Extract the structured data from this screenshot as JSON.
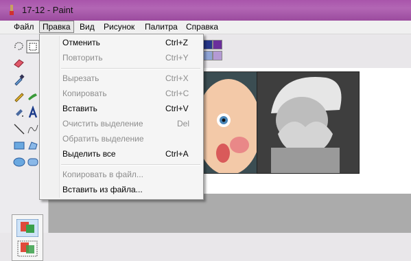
{
  "window": {
    "title": "17-12 - Paint",
    "app_icon": "paint-icon"
  },
  "menubar": {
    "items": [
      {
        "label": "Файл"
      },
      {
        "label": "Правка",
        "active": true
      },
      {
        "label": "Вид"
      },
      {
        "label": "Рисунок"
      },
      {
        "label": "Палитра"
      },
      {
        "label": "Справка"
      }
    ]
  },
  "edit_menu": {
    "items": [
      {
        "label": "Отменить",
        "shortcut": "Ctrl+Z",
        "enabled": true
      },
      {
        "label": "Повторить",
        "shortcut": "Ctrl+Y",
        "enabled": false
      },
      {
        "label": "Вырезать",
        "shortcut": "Ctrl+X",
        "enabled": false
      },
      {
        "label": "Копировать",
        "shortcut": "Ctrl+C",
        "enabled": false
      },
      {
        "label": "Вставить",
        "shortcut": "Ctrl+V",
        "enabled": true
      },
      {
        "label": "Очистить выделение",
        "shortcut": "Del",
        "enabled": false
      },
      {
        "label": "Обратить выделение",
        "shortcut": "",
        "enabled": false
      },
      {
        "label": "Выделить все",
        "shortcut": "Ctrl+A",
        "enabled": true
      },
      {
        "label": "Копировать в файл...",
        "shortcut": "",
        "enabled": false
      },
      {
        "label": "Вставить из файла...",
        "shortcut": "",
        "enabled": true
      }
    ]
  },
  "toolbox": {
    "tools": [
      "free-select-icon",
      "rect-select-icon",
      "eraser-icon",
      "fill-icon",
      "eyedropper-icon",
      "magnifier-icon",
      "pencil-icon",
      "brush-icon",
      "airbrush-icon",
      "text-icon",
      "line-icon",
      "curve-icon",
      "rectangle-icon",
      "polygon-icon",
      "ellipse-icon",
      "rounded-rect-icon"
    ]
  },
  "palette": {
    "colors": [
      "#26378a",
      "#6a2e9b",
      "#8fa4d6",
      "#b49ad4"
    ]
  }
}
